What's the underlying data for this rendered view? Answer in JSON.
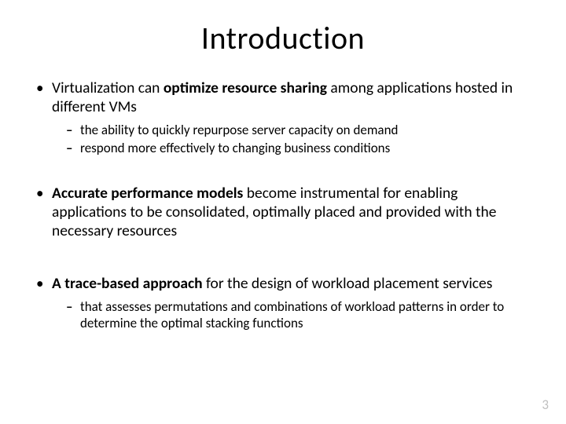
{
  "title": "Introduction",
  "bullets": {
    "b1": {
      "pre": "Virtualization can ",
      "bold": "optimize resource sharing ",
      "post": "among applications hosted in different VMs",
      "sub1": "the ability to quickly repurpose server capacity on demand",
      "sub2": "respond more effectively to changing business conditions"
    },
    "b2": {
      "bold": "Accurate performance models",
      "post": " become instrumental for enabling applications to be consolidated, optimally placed and provided with the necessary resources"
    },
    "b3": {
      "bold": "A trace-based approach ",
      "post": "for the design of workload placement services",
      "sub1": "that assesses permutations and combinations of workload patterns in order to determine the optimal stacking functions"
    }
  },
  "page_number": "3"
}
